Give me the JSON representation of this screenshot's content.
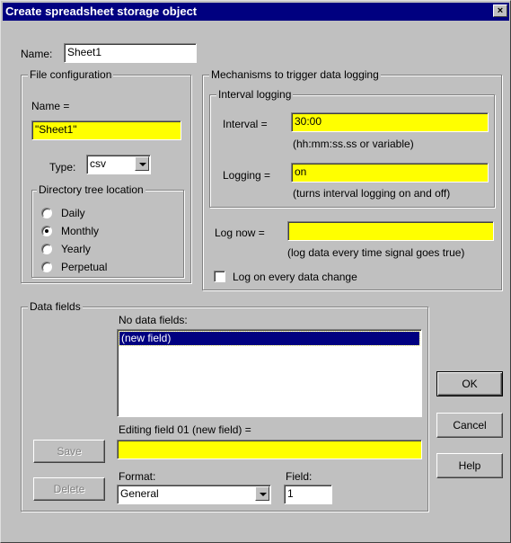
{
  "window": {
    "title": "Create spreadsheet storage object",
    "close_label": "×"
  },
  "name": {
    "label": "Name:",
    "value": "Sheet1"
  },
  "file_config": {
    "title": "File configuration",
    "name_label": "Name =",
    "name_value": "\"Sheet1\"",
    "type_label": "Type:",
    "type_value": "csv",
    "dir_tree": {
      "title": "Directory tree location",
      "options": [
        "Daily",
        "Monthly",
        "Yearly",
        "Perpetual"
      ],
      "selected": "Monthly"
    }
  },
  "mechanisms": {
    "title": "Mechanisms to trigger data logging",
    "interval_group": {
      "title": "Interval logging",
      "interval_label": "Interval =",
      "interval_value": "30:00",
      "interval_hint": "(hh:mm:ss.ss or variable)",
      "logging_label": "Logging =",
      "logging_value": "on",
      "logging_hint": "(turns interval logging on and off)"
    },
    "lognow_label": "Log now =",
    "lognow_value": "",
    "lognow_hint": "(log data every time signal goes true)",
    "on_change_label": "Log on every data change",
    "on_change_checked": false
  },
  "data_fields": {
    "title": "Data fields",
    "list_header": "No data fields:",
    "list_items": [
      "(new field)"
    ],
    "editing_label": "Editing field 01 (new field) =",
    "editing_value": "",
    "save_label": "Save",
    "delete_label": "Delete",
    "format_label": "Format:",
    "format_value": "General",
    "field_label": "Field:",
    "field_value": "1"
  },
  "buttons": {
    "ok": "OK",
    "cancel": "Cancel",
    "help": "Help"
  },
  "colors": {
    "titlebar": "#000080",
    "highlight_field": "#ffff00",
    "face": "#c0c0c0"
  }
}
